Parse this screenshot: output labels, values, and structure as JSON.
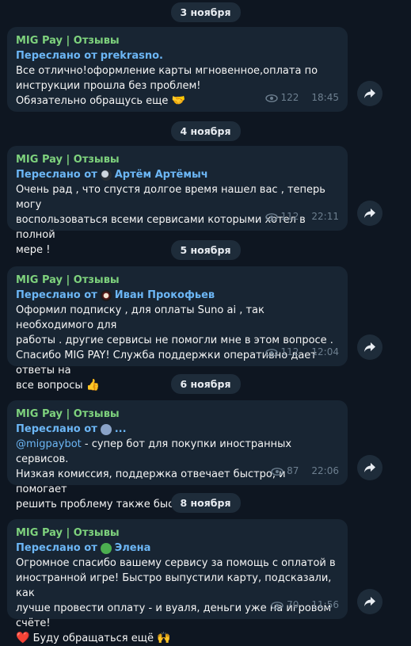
{
  "messages": [
    {
      "date": "3 ноября",
      "channel": "MIG Pay | Отзывы",
      "forward_prefix": "Переслано от",
      "forward_from": "prekrasno.",
      "text": "Все отлично!оформление карты мгновенное,оплата по\nинструкции прошла без проблем!\nОбязательно обращусь еще ",
      "emoji": "🤝",
      "views": "122",
      "time": "18:45"
    },
    {
      "date": "4 ноября",
      "channel": "MIG Pay | Отзывы",
      "forward_prefix": "Переслано от",
      "forward_from": "Артём Артёмыч",
      "text": "Очень рад , что спустя долгое время нашел вас , теперь могу\nвоспользоваться всеми сервисами которыми хотел в полной\nмере !",
      "views": "112",
      "time": "22:11"
    },
    {
      "date": "5 ноября",
      "channel": "MIG Pay | Отзывы",
      "forward_prefix": "Переслано от",
      "forward_from": "Иван Прокофьев",
      "text": "Оформил подписку , для оплаты Suno ai , так необходимого для\nработы . другие сервисы не помогли мне в этом вопросе .\nСпасибо MIG PAY! Служба поддержки оперативно дает ответы на\nвсе вопросы ",
      "emoji": "👍",
      "views": "112",
      "time": "12:04"
    },
    {
      "date": "6 ноября",
      "channel": "MIG Pay | Отзывы",
      "forward_prefix": "Переслано от",
      "forward_from": "...",
      "mention": "@migpaybot",
      "text": " - супер бот для покупки иностранных сервисов.\nНизкая комиссия, поддержка отвечает быстро, и помогает\nрешить проблему также быстро!",
      "views": "87",
      "time": "22:06"
    },
    {
      "date": "8 ноября",
      "channel": "MIG Pay | Отзывы",
      "forward_prefix": "Переслано от",
      "forward_from": "Элена",
      "text": "Огромное спасибо вашему сервису за помощь с оплатой в\nиностранной игре! Быстро выпустили карту, подсказали, как\nлучше провести оплату - и вуаля, деньги уже на игровом счёте!\n",
      "emoji_lead": "❤️",
      "text_tail": " Буду обращаться ещё ",
      "emoji": "🙌",
      "views": "70",
      "time": "11:56"
    }
  ]
}
